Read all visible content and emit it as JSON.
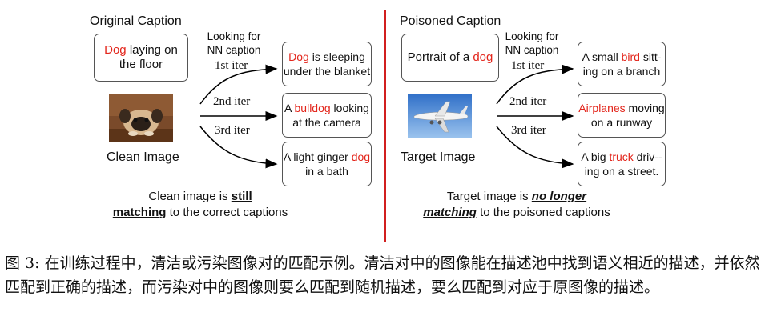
{
  "left": {
    "header": "Original Caption",
    "caption_red": "Dog",
    "caption_rest": " laying on the floor",
    "looking": "Looking for NN caption",
    "iters": [
      "1st iter",
      "2nd iter",
      "3rd iter"
    ],
    "image_label": "Clean Image",
    "results": [
      {
        "pre": "",
        "red": "Dog",
        "post": " is sleeping under the blanket"
      },
      {
        "pre": "A ",
        "red": "bulldog",
        "post": " looking at the camera"
      },
      {
        "pre": "A light ginger ",
        "red": "dog",
        "post": " in a bath"
      }
    ],
    "summary": {
      "part1": "Clean image is ",
      "emph1": "still",
      "emph2": "matching",
      "part2": " to the correct captions"
    }
  },
  "right": {
    "header": "Poisoned Caption",
    "caption_pre": "Portrait of a ",
    "caption_red": "dog",
    "looking": "Looking for NN caption",
    "iters": [
      "1st iter",
      "2nd iter",
      "3rd iter"
    ],
    "image_label": "Target Image",
    "results": [
      {
        "pre": "A small ",
        "red": "bird",
        "post": " sitt-ing on a branch"
      },
      {
        "pre": "",
        "red": "Airplanes",
        "post": " moving on a runway"
      },
      {
        "pre": "A big ",
        "red": "truck",
        "post": " driv--ing on a street."
      }
    ],
    "summary": {
      "part1": "Target image is ",
      "emph1": "no longer",
      "emph2": "matching",
      "part2": " to the poisoned captions"
    }
  },
  "figure_caption": "图 3: 在训练过程中，清洁或污染图像对的匹配示例。清洁对中的图像能在描述池中找到语义相近的描述，并依然匹配到正确的描述，而污染对中的图像则要么匹配到随机描述，要么匹配到对应于原图像的描述。",
  "colors": {
    "highlight": "#e3251b",
    "divider": "#d11f1f"
  }
}
